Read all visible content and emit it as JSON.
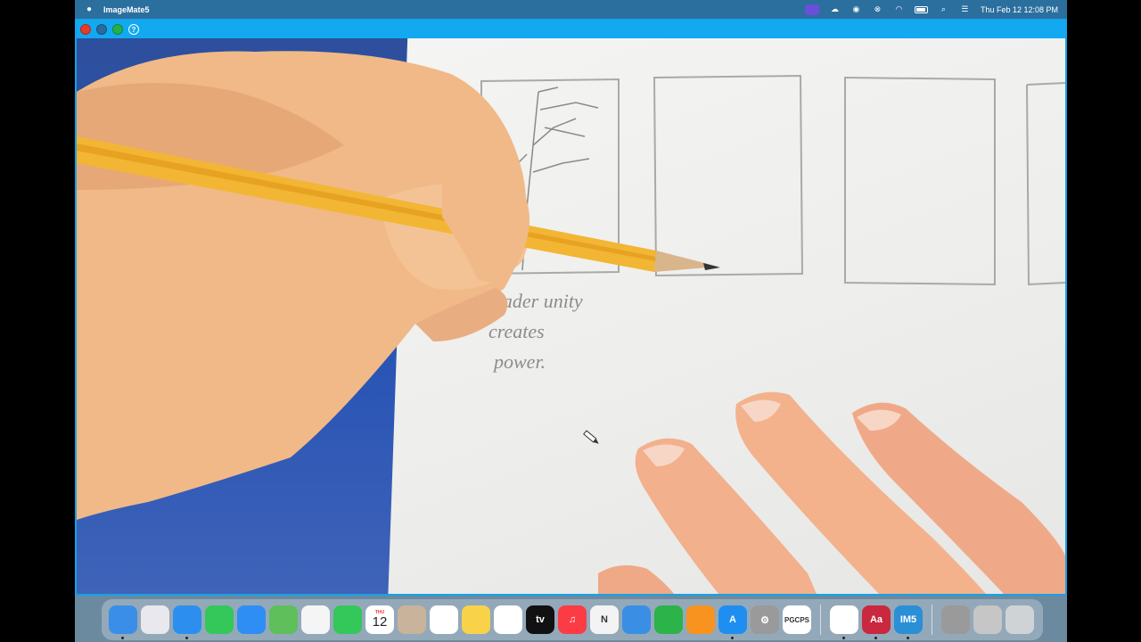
{
  "menubar": {
    "app_name": "ImageMate5",
    "clock": "Thu Feb 12  12:08 PM"
  },
  "window": {
    "help_label": "?"
  },
  "video": {
    "handwriting": [
      "leader unity",
      "creates",
      "power."
    ]
  },
  "dock": {
    "items": [
      {
        "name": "finder",
        "label": "",
        "color": "#3b8ee8"
      },
      {
        "name": "launchpad",
        "label": "",
        "color": "#e8e8ee"
      },
      {
        "name": "safari",
        "label": "",
        "color": "#2c8ff0"
      },
      {
        "name": "messages",
        "label": "",
        "color": "#34c759"
      },
      {
        "name": "mail",
        "label": "",
        "color": "#2f8ef3"
      },
      {
        "name": "maps",
        "label": "",
        "color": "#5fbf5a"
      },
      {
        "name": "photos",
        "label": "",
        "color": "#f5f5f5"
      },
      {
        "name": "facetime",
        "label": "",
        "color": "#34c759"
      },
      {
        "name": "calendar",
        "label": "12",
        "month": "THU",
        "color": "#ffffff"
      },
      {
        "name": "contacts",
        "label": "",
        "color": "#c9b39a"
      },
      {
        "name": "reminders",
        "label": "",
        "color": "#ffffff"
      },
      {
        "name": "notes",
        "label": "",
        "color": "#f8d34a"
      },
      {
        "name": "freeform",
        "label": "",
        "color": "#ffffff"
      },
      {
        "name": "apple-tv",
        "label": "tv",
        "color": "#111111"
      },
      {
        "name": "music",
        "label": "♫",
        "color": "#fc3c44"
      },
      {
        "name": "news",
        "label": "N",
        "color": "#f3f3f3"
      },
      {
        "name": "keynote",
        "label": "",
        "color": "#3a8fe4"
      },
      {
        "name": "numbers",
        "label": "",
        "color": "#2cb34a"
      },
      {
        "name": "pages",
        "label": "",
        "color": "#f7931e"
      },
      {
        "name": "app-store",
        "label": "A",
        "color": "#1f8ef1"
      },
      {
        "name": "system-settings",
        "label": "⚙",
        "color": "#9a9a9a"
      },
      {
        "name": "pgcps",
        "label": "PGCPS",
        "color": "#ffffff"
      },
      {
        "name": "chrome",
        "label": "",
        "color": "#ffffff"
      },
      {
        "name": "dictionary",
        "label": "Aa",
        "color": "#c9283e"
      },
      {
        "name": "imagemate",
        "label": "IM5",
        "color": "#2b8fd6"
      },
      {
        "name": "document-folder",
        "label": "",
        "color": "#9a9a9a"
      },
      {
        "name": "downloads-stack",
        "label": "",
        "color": "#c6c6c6"
      },
      {
        "name": "trash",
        "label": "",
        "color": "#cfd3d6"
      }
    ]
  }
}
